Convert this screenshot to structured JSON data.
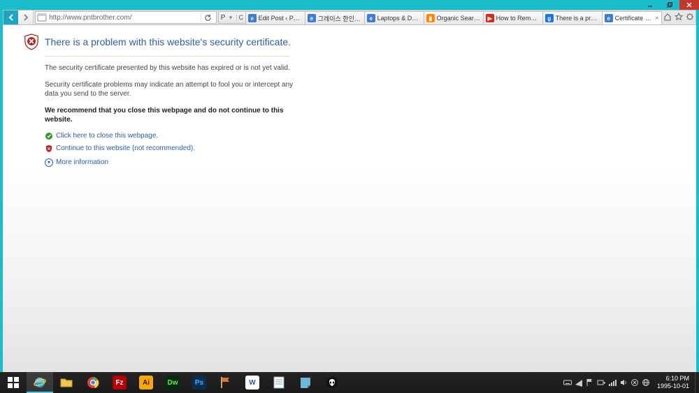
{
  "window_controls": {
    "min": "minimize",
    "max": "restore",
    "close": "close"
  },
  "address_bar": {
    "url": "http://www.pntbrother.com/",
    "search_label": "P",
    "refresh_label": "C"
  },
  "tabs": [
    {
      "label": "Edit Post ‹ P&T IT ...",
      "favicon_bg": "#3b7dd8",
      "favicon_txt": "e",
      "favicon_color": "#fff"
    },
    {
      "label": "그레이스 한인교회",
      "favicon_bg": "#3b7dd8",
      "favicon_txt": "e",
      "favicon_color": "#fff"
    },
    {
      "label": "Laptops & Deskto...",
      "favicon_bg": "#3b7dd8",
      "favicon_txt": "e",
      "favicon_color": "#fff"
    },
    {
      "label": "Organic Search Tr...",
      "favicon_bg": "#ff8a00",
      "favicon_txt": "▮",
      "favicon_color": "#fff"
    },
    {
      "label": "How to Remove S...",
      "favicon_bg": "#e62117",
      "favicon_txt": "▶",
      "favicon_color": "#fff"
    },
    {
      "label": "There is a proble...",
      "favicon_bg": "#1a73e8",
      "favicon_txt": "g",
      "favicon_color": "#fff"
    },
    {
      "label": "Certificate Erro...",
      "favicon_bg": "#3b7dd8",
      "favicon_txt": "e",
      "favicon_color": "#fff",
      "active": true,
      "closable": true
    }
  ],
  "ie_right_icons": [
    "home",
    "star",
    "gear"
  ],
  "cert_page": {
    "title": "There is a problem with this website's security certificate.",
    "line1": "The security certificate presented by this website has expired or is not yet valid.",
    "line2": "Security certificate problems may indicate an attempt to fool you or intercept any data you send to the server.",
    "recommend": "We recommend that you close this webpage and do not continue to this website.",
    "close_link": "Click here to close this webpage.",
    "continue_link": "Continue to this website (not recommended).",
    "more_info": "More information"
  },
  "taskbar": {
    "apps": [
      {
        "name": "start",
        "type": "start"
      },
      {
        "name": "internet-explorer",
        "type": "ie",
        "active": true
      },
      {
        "name": "file-explorer",
        "type": "folder"
      },
      {
        "name": "chrome",
        "type": "chrome"
      },
      {
        "name": "filezilla",
        "type": "box",
        "bg": "#b90000",
        "txt": "Fz",
        "color": "#fff"
      },
      {
        "name": "illustrator",
        "type": "box",
        "bg": "#f7a800",
        "txt": "Ai",
        "color": "#3a1700"
      },
      {
        "name": "dreamweaver",
        "type": "box",
        "bg": "#072b11",
        "txt": "Dw",
        "color": "#6fe24b"
      },
      {
        "name": "photoshop",
        "type": "box",
        "bg": "#0b2e4f",
        "txt": "Ps",
        "color": "#3fb1ff"
      },
      {
        "name": "app-flag",
        "type": "flag"
      },
      {
        "name": "word",
        "type": "box",
        "bg": "#fff",
        "txt": "W",
        "color": "#2b579a"
      },
      {
        "name": "notepad",
        "type": "note"
      },
      {
        "name": "sticky-notes",
        "type": "sticky"
      },
      {
        "name": "alien-app",
        "type": "alien"
      }
    ],
    "sys": [
      "keyboard",
      "action",
      "flag-white",
      "signal",
      "bars",
      "speaker",
      "sync",
      "globe"
    ],
    "clock_time": "6:10 PM",
    "clock_date": "1995-10-01"
  }
}
